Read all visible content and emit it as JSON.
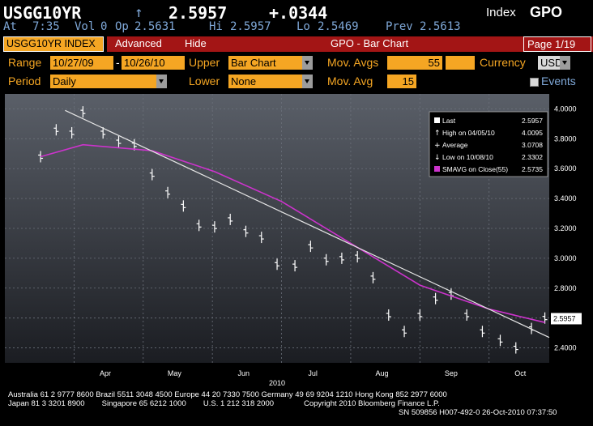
{
  "header": {
    "ticker": "USGG10YR",
    "arrow": "↑",
    "price": "2.5957",
    "change": "+.0344",
    "index_label": "Index",
    "index_code": "GPO",
    "at_label": "At",
    "time": "7:35",
    "vol_label": "Vol",
    "vol": "0",
    "op_label": "Op",
    "open": "2.5631",
    "hi_label": "Hi",
    "high": "2.5957",
    "lo_label": "Lo",
    "low": "2.5469",
    "prev_label": "Prev",
    "prev": "2.5613"
  },
  "tabs": {
    "index_tab": "USGG10YR INDEX",
    "advanced": "Advanced",
    "hide": "Hide",
    "title": "GPO - Bar Chart",
    "page": "Page 1/19"
  },
  "controls": {
    "range_label": "Range",
    "range_from": "10/27/09",
    "range_sep": "-",
    "range_to": "10/26/10",
    "upper_label": "Upper",
    "upper_value": "Bar Chart",
    "mov_avgs_label": "Mov. Avgs",
    "mov_avgs_value": "55",
    "currency_label": "Currency",
    "currency_value": "USD",
    "period_label": "Period",
    "period_value": "Daily",
    "lower_label": "Lower",
    "lower_value": "None",
    "mov_avg_label": "Mov. Avg",
    "mov_avg_value": "15",
    "events_label": "Events"
  },
  "legend": {
    "last_label": "Last",
    "last_value": "2.5957",
    "high_label": "High on 04/05/10",
    "high_value": "4.0095",
    "avg_label": "Average",
    "avg_value": "3.0708",
    "low_label": "Low on 10/08/10",
    "low_value": "2.3302",
    "sma_label": "SMAVG on Close(55)",
    "sma_value": "2.5735"
  },
  "colors": {
    "amber": "#f5a623",
    "sma": "#cc33cc",
    "trend": "#e6e6e6",
    "bars": "#ffffff"
  },
  "chart_data": {
    "type": "line",
    "title": "",
    "xlabel": "2010",
    "ylabel": "",
    "x_ticks": [
      "Apr",
      "May",
      "Jun",
      "Jul",
      "Aug",
      "Sep",
      "Oct"
    ],
    "y_ticks": [
      "4.0000",
      "3.8000",
      "3.6000",
      "3.4000",
      "3.2000",
      "3.0000",
      "2.8000",
      "2.6000",
      "2.4000"
    ],
    "ylim": [
      2.3,
      4.1
    ],
    "price_tag": "2.5957",
    "series": [
      {
        "name": "Last",
        "kind": "bar",
        "x": [
          "03/17",
          "03/24",
          "03/31",
          "04/05",
          "04/14",
          "04/21",
          "04/28",
          "05/05",
          "05/12",
          "05/19",
          "05/26",
          "06/02",
          "06/09",
          "06/16",
          "06/23",
          "06/30",
          "07/07",
          "07/14",
          "07/21",
          "07/28",
          "08/04",
          "08/11",
          "08/18",
          "08/25",
          "09/01",
          "09/08",
          "09/15",
          "09/22",
          "09/29",
          "10/06",
          "10/13",
          "10/20",
          "10/26"
        ],
        "values": [
          3.68,
          3.86,
          3.84,
          3.98,
          3.84,
          3.78,
          3.76,
          3.56,
          3.44,
          3.35,
          3.22,
          3.21,
          3.26,
          3.18,
          3.14,
          2.96,
          2.95,
          3.08,
          2.99,
          3.0,
          3.01,
          2.87,
          2.62,
          2.51,
          2.62,
          2.73,
          2.76,
          2.62,
          2.51,
          2.45,
          2.4,
          2.53,
          2.6
        ]
      },
      {
        "name": "SMAVG on Close(55)",
        "kind": "line",
        "x": [
          "03/17",
          "04/05",
          "05/05",
          "06/02",
          "07/01",
          "08/01",
          "09/01",
          "10/01",
          "10/26"
        ],
        "values": [
          3.68,
          3.76,
          3.72,
          3.58,
          3.38,
          3.1,
          2.82,
          2.66,
          2.57
        ]
      }
    ]
  },
  "footer": {
    "line1": "Australia 61 2 9777 8600 Brazil 5511 3048 4500 Europe 44 20 7330 7500 Germany 49 69 9204 1210 Hong Kong 852 2977 6000",
    "line2": "Japan 81 3 3201 8900        Singapore 65 6212 1000        U.S. 1 212 318 2000              Copyright 2010 Bloomberg Finance L.P.",
    "line3": "SN 509856 H007-492-0 26-Oct-2010 07:37:50"
  }
}
